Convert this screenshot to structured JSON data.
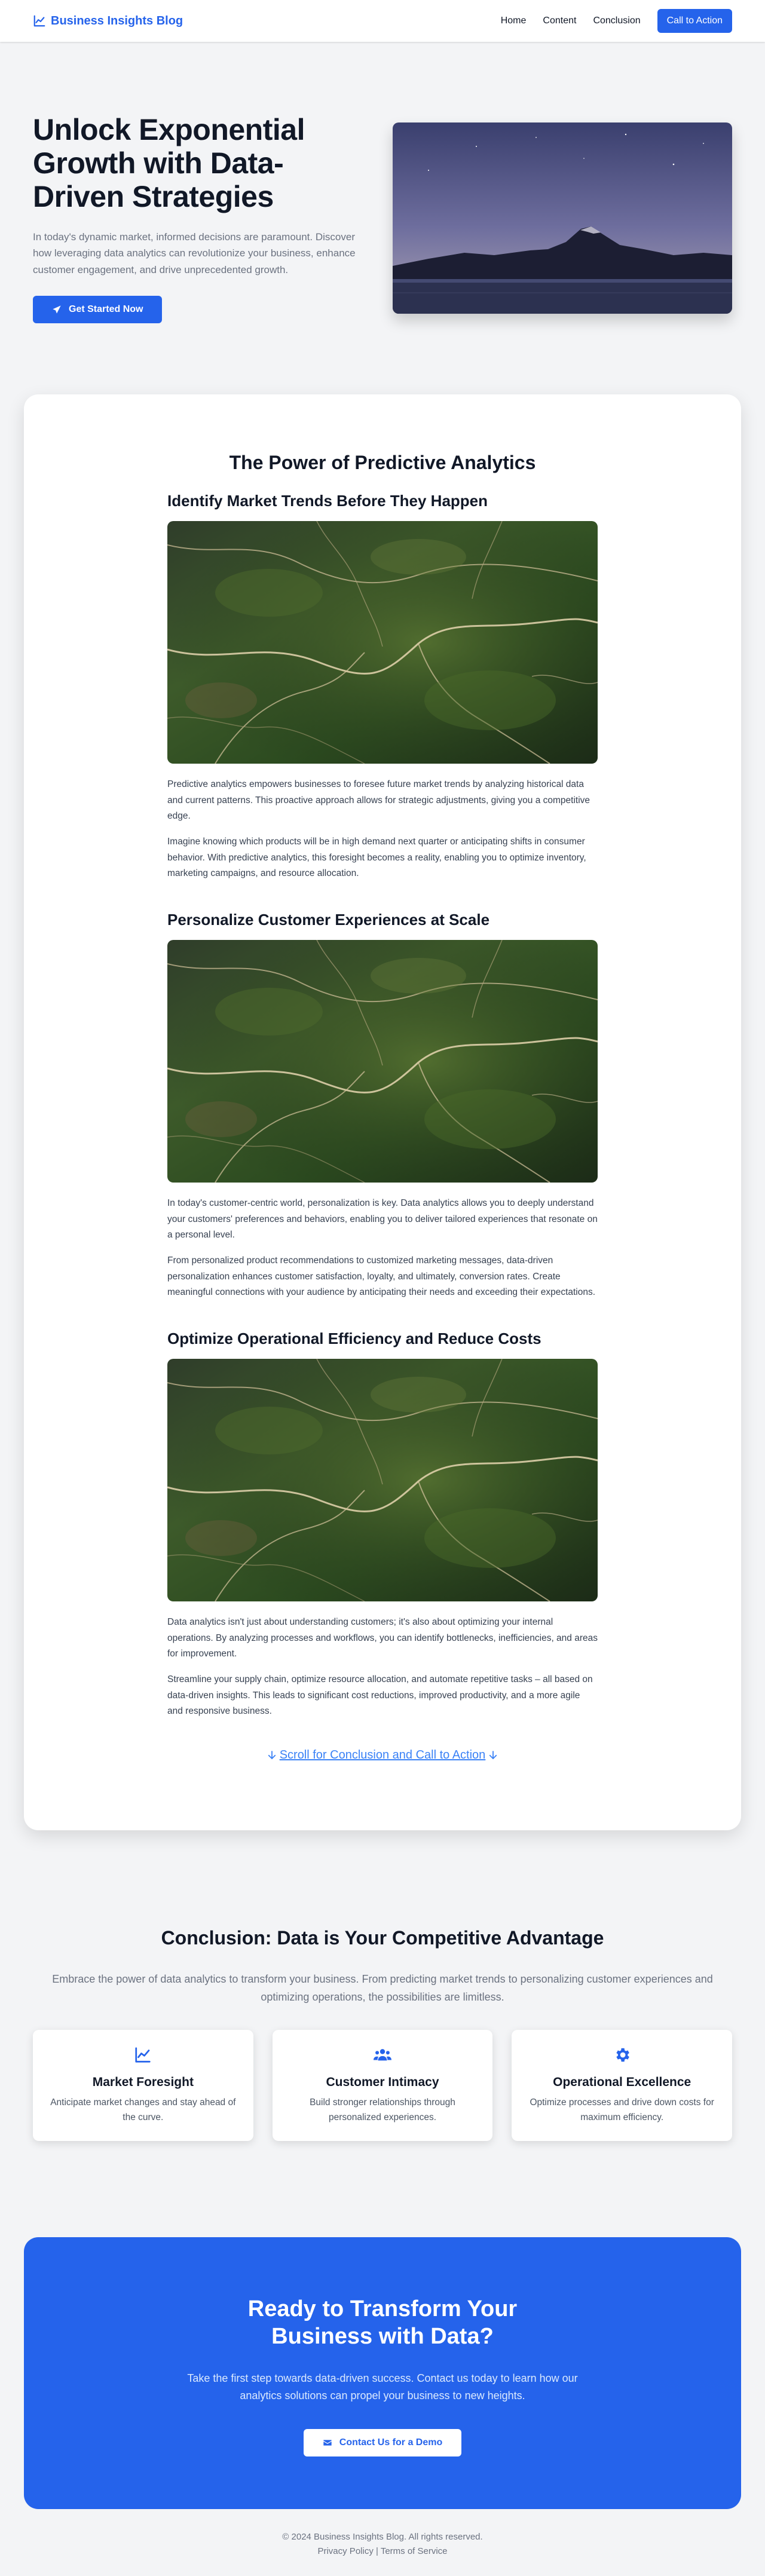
{
  "nav": {
    "brand": "Business Insights Blog",
    "links": [
      "Home",
      "Content",
      "Conclusion"
    ],
    "cta_label": "Call to Action"
  },
  "hero": {
    "title": "Unlock Exponential Growth with Data-Driven Strategies",
    "text": "In today's dynamic market, informed decisions are paramount. Discover how leveraging data analytics can revolutionize your business, enhance customer engagement, and drive unprecedented growth.",
    "button_label": "Get Started Now",
    "image_icon": "mountain-night-sky-image"
  },
  "content": {
    "title": "The Power of Predictive Analytics",
    "sections": [
      {
        "title": "Identify Market Trends Before They Happen",
        "image_icon": "aerial-landscape-image",
        "paragraphs": [
          "Predictive analytics empowers businesses to foresee future market trends by analyzing historical data and current patterns. This proactive approach allows for strategic adjustments, giving you a competitive edge.",
          "Imagine knowing which products will be in high demand next quarter or anticipating shifts in consumer behavior. With predictive analytics, this foresight becomes a reality, enabling you to optimize inventory, marketing campaigns, and resource allocation."
        ]
      },
      {
        "title": "Personalize Customer Experiences at Scale",
        "image_icon": "aerial-landscape-image",
        "paragraphs": [
          "In today's customer-centric world, personalization is key. Data analytics allows you to deeply understand your customers' preferences and behaviors, enabling you to deliver tailored experiences that resonate on a personal level.",
          "From personalized product recommendations to customized marketing messages, data-driven personalization enhances customer satisfaction, loyalty, and ultimately, conversion rates. Create meaningful connections with your audience by anticipating their needs and exceeding their expectations."
        ]
      },
      {
        "title": "Optimize Operational Efficiency and Reduce Costs",
        "image_icon": "aerial-landscape-image",
        "paragraphs": [
          "Data analytics isn't just about understanding customers; it's also about optimizing your internal operations. By analyzing processes and workflows, you can identify bottlenecks, inefficiencies, and areas for improvement.",
          "Streamline your supply chain, optimize resource allocation, and automate repetitive tasks – all based on data-driven insights. This leads to significant cost reductions, improved productivity, and a more agile and responsive business."
        ]
      }
    ],
    "scroll_label": "Scroll for Conclusion and Call to Action"
  },
  "conclusion": {
    "title": "Conclusion: Data is Your Competitive Advantage",
    "text": "Embrace the power of data analytics to transform your business. From predicting market trends to personalizing customer experiences and optimizing operations, the possibilities are limitless.",
    "features": [
      {
        "icon": "line-chart-icon",
        "title": "Market Foresight",
        "desc": "Anticipate market changes and stay ahead of the curve."
      },
      {
        "icon": "users-icon",
        "title": "Customer Intimacy",
        "desc": "Build stronger relationships through personalized experiences."
      },
      {
        "icon": "gear-icon",
        "title": "Operational Excellence",
        "desc": "Optimize processes and drive down costs for maximum efficiency."
      }
    ]
  },
  "cta": {
    "title": "Ready to Transform Your Business with Data?",
    "text": "Take the first step towards data-driven success. Contact us today to learn how our analytics solutions can propel your business to new heights.",
    "button_label": "Contact Us for a Demo"
  },
  "footer": {
    "copyright": "© 2024 Business Insights Blog. All rights reserved.",
    "privacy": "Privacy Policy",
    "separator": "|",
    "terms": "Terms of Service"
  },
  "colors": {
    "accent": "#2563eb",
    "background": "#f3f4f6",
    "link": "#3b82f6"
  }
}
